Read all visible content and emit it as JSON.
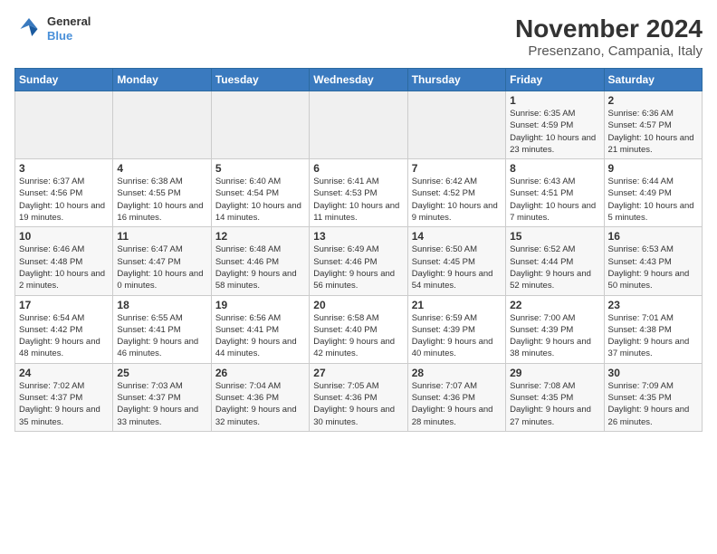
{
  "logo": {
    "line1": "General",
    "line2": "Blue"
  },
  "title": "November 2024",
  "subtitle": "Presenzano, Campania, Italy",
  "weekdays": [
    "Sunday",
    "Monday",
    "Tuesday",
    "Wednesday",
    "Thursday",
    "Friday",
    "Saturday"
  ],
  "weeks": [
    [
      {
        "day": "",
        "info": ""
      },
      {
        "day": "",
        "info": ""
      },
      {
        "day": "",
        "info": ""
      },
      {
        "day": "",
        "info": ""
      },
      {
        "day": "",
        "info": ""
      },
      {
        "day": "1",
        "info": "Sunrise: 6:35 AM\nSunset: 4:59 PM\nDaylight: 10 hours and 23 minutes."
      },
      {
        "day": "2",
        "info": "Sunrise: 6:36 AM\nSunset: 4:57 PM\nDaylight: 10 hours and 21 minutes."
      }
    ],
    [
      {
        "day": "3",
        "info": "Sunrise: 6:37 AM\nSunset: 4:56 PM\nDaylight: 10 hours and 19 minutes."
      },
      {
        "day": "4",
        "info": "Sunrise: 6:38 AM\nSunset: 4:55 PM\nDaylight: 10 hours and 16 minutes."
      },
      {
        "day": "5",
        "info": "Sunrise: 6:40 AM\nSunset: 4:54 PM\nDaylight: 10 hours and 14 minutes."
      },
      {
        "day": "6",
        "info": "Sunrise: 6:41 AM\nSunset: 4:53 PM\nDaylight: 10 hours and 11 minutes."
      },
      {
        "day": "7",
        "info": "Sunrise: 6:42 AM\nSunset: 4:52 PM\nDaylight: 10 hours and 9 minutes."
      },
      {
        "day": "8",
        "info": "Sunrise: 6:43 AM\nSunset: 4:51 PM\nDaylight: 10 hours and 7 minutes."
      },
      {
        "day": "9",
        "info": "Sunrise: 6:44 AM\nSunset: 4:49 PM\nDaylight: 10 hours and 5 minutes."
      }
    ],
    [
      {
        "day": "10",
        "info": "Sunrise: 6:46 AM\nSunset: 4:48 PM\nDaylight: 10 hours and 2 minutes."
      },
      {
        "day": "11",
        "info": "Sunrise: 6:47 AM\nSunset: 4:47 PM\nDaylight: 10 hours and 0 minutes."
      },
      {
        "day": "12",
        "info": "Sunrise: 6:48 AM\nSunset: 4:46 PM\nDaylight: 9 hours and 58 minutes."
      },
      {
        "day": "13",
        "info": "Sunrise: 6:49 AM\nSunset: 4:46 PM\nDaylight: 9 hours and 56 minutes."
      },
      {
        "day": "14",
        "info": "Sunrise: 6:50 AM\nSunset: 4:45 PM\nDaylight: 9 hours and 54 minutes."
      },
      {
        "day": "15",
        "info": "Sunrise: 6:52 AM\nSunset: 4:44 PM\nDaylight: 9 hours and 52 minutes."
      },
      {
        "day": "16",
        "info": "Sunrise: 6:53 AM\nSunset: 4:43 PM\nDaylight: 9 hours and 50 minutes."
      }
    ],
    [
      {
        "day": "17",
        "info": "Sunrise: 6:54 AM\nSunset: 4:42 PM\nDaylight: 9 hours and 48 minutes."
      },
      {
        "day": "18",
        "info": "Sunrise: 6:55 AM\nSunset: 4:41 PM\nDaylight: 9 hours and 46 minutes."
      },
      {
        "day": "19",
        "info": "Sunrise: 6:56 AM\nSunset: 4:41 PM\nDaylight: 9 hours and 44 minutes."
      },
      {
        "day": "20",
        "info": "Sunrise: 6:58 AM\nSunset: 4:40 PM\nDaylight: 9 hours and 42 minutes."
      },
      {
        "day": "21",
        "info": "Sunrise: 6:59 AM\nSunset: 4:39 PM\nDaylight: 9 hours and 40 minutes."
      },
      {
        "day": "22",
        "info": "Sunrise: 7:00 AM\nSunset: 4:39 PM\nDaylight: 9 hours and 38 minutes."
      },
      {
        "day": "23",
        "info": "Sunrise: 7:01 AM\nSunset: 4:38 PM\nDaylight: 9 hours and 37 minutes."
      }
    ],
    [
      {
        "day": "24",
        "info": "Sunrise: 7:02 AM\nSunset: 4:37 PM\nDaylight: 9 hours and 35 minutes."
      },
      {
        "day": "25",
        "info": "Sunrise: 7:03 AM\nSunset: 4:37 PM\nDaylight: 9 hours and 33 minutes."
      },
      {
        "day": "26",
        "info": "Sunrise: 7:04 AM\nSunset: 4:36 PM\nDaylight: 9 hours and 32 minutes."
      },
      {
        "day": "27",
        "info": "Sunrise: 7:05 AM\nSunset: 4:36 PM\nDaylight: 9 hours and 30 minutes."
      },
      {
        "day": "28",
        "info": "Sunrise: 7:07 AM\nSunset: 4:36 PM\nDaylight: 9 hours and 28 minutes."
      },
      {
        "day": "29",
        "info": "Sunrise: 7:08 AM\nSunset: 4:35 PM\nDaylight: 9 hours and 27 minutes."
      },
      {
        "day": "30",
        "info": "Sunrise: 7:09 AM\nSunset: 4:35 PM\nDaylight: 9 hours and 26 minutes."
      }
    ]
  ]
}
